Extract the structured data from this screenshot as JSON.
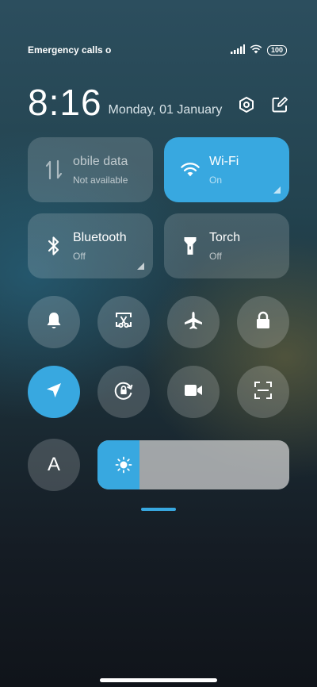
{
  "status_bar": {
    "carrier": "Emergency calls o",
    "battery": "100"
  },
  "header": {
    "time": "8:16",
    "date": "Monday, 01 January"
  },
  "tiles": {
    "mobile_data": {
      "label": "obile data",
      "state": "Not available"
    },
    "wifi": {
      "label": "Wi-Fi",
      "state": "On"
    },
    "bluetooth": {
      "label": "Bluetooth",
      "state": "Off"
    },
    "torch": {
      "label": "Torch",
      "state": "Off"
    }
  },
  "toggles": [
    {
      "name": "ringer",
      "icon": "bell-icon",
      "active": false
    },
    {
      "name": "screenshot",
      "icon": "scissors-screenshot-icon",
      "active": false
    },
    {
      "name": "airplane-mode",
      "icon": "airplane-icon",
      "active": false
    },
    {
      "name": "lock-screen",
      "icon": "lock-icon",
      "active": false
    },
    {
      "name": "location",
      "icon": "location-arrow-icon",
      "active": true
    },
    {
      "name": "auto-rotate",
      "icon": "rotation-lock-icon",
      "active": false
    },
    {
      "name": "screen-recorder",
      "icon": "video-camera-icon",
      "active": false
    },
    {
      "name": "scanner",
      "icon": "scan-icon",
      "active": false
    }
  ],
  "auto_brightness": {
    "label": "A"
  },
  "brightness": {
    "level": 0.22
  },
  "colors": {
    "accent": "#38a8e0",
    "tile_bg": "rgba(255,255,255,0.16)"
  }
}
